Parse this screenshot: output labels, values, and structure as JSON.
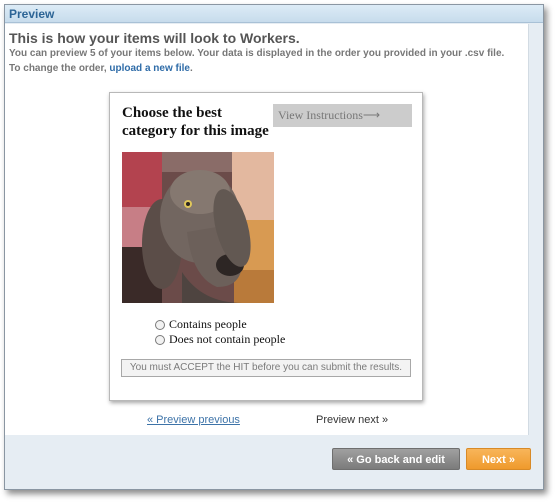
{
  "header": {
    "title": "Preview"
  },
  "intro": {
    "title": "This is how your items will look to Workers.",
    "line1": "You can preview 5 of your items below. Your data is displayed in the order you provided in your .csv file.",
    "line2_prefix": "To change the order,",
    "line2_link": "upload a new file",
    "line2_suffix": "."
  },
  "hit": {
    "question": "Choose the best category for this image",
    "view_instructions": "View Instructions⟶",
    "image_icon": "dog-photo",
    "options": [
      "Contains people",
      "Does not contain people"
    ],
    "accept_notice": "You must ACCEPT the HIT before you can submit the results."
  },
  "pager": {
    "previous": "« Preview previous",
    "next": "Preview next »"
  },
  "actions": {
    "back": "« Go back and edit",
    "next": "Next »"
  },
  "colors": {
    "accent_blue": "#2d6596",
    "next_orange": "#ef9a2c",
    "back_gray": "#7b7b7b"
  }
}
